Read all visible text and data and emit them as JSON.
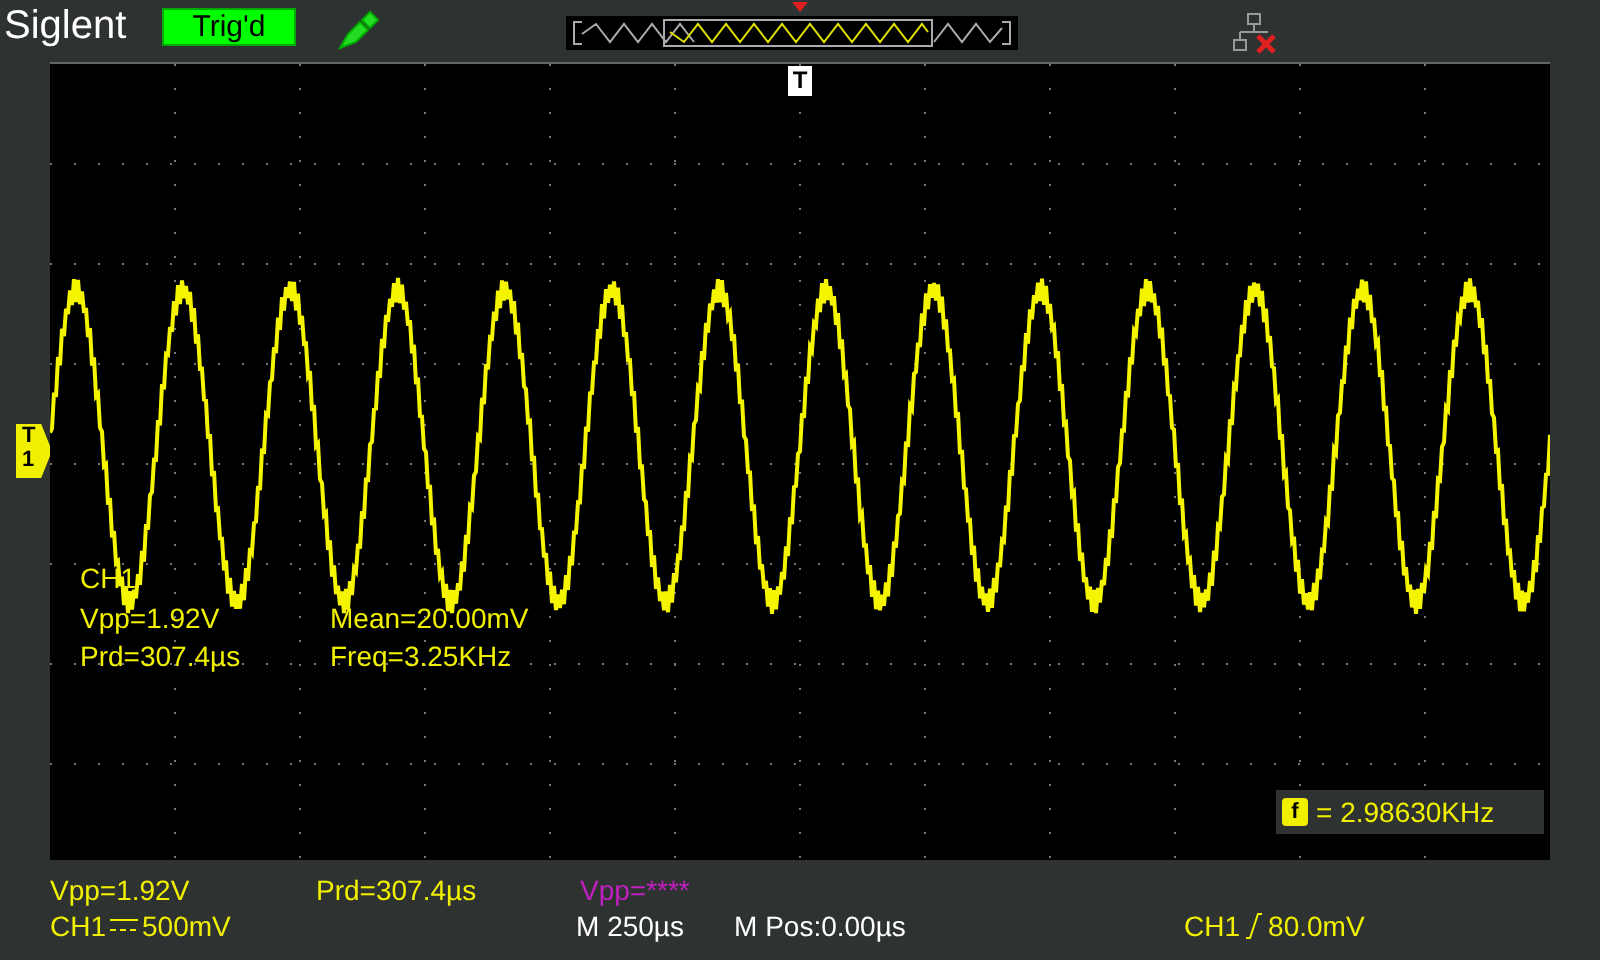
{
  "header": {
    "brand": "Siglent",
    "trigger_status": "Trig'd"
  },
  "markers": {
    "trigger_position": "T",
    "channel_marker": [
      "T",
      "1"
    ]
  },
  "measurements": [
    {
      "label": "CH1"
    },
    {
      "label": "Vpp=1.92V"
    },
    {
      "label": "Mean=20.00mV"
    },
    {
      "label": "Prd=307.4µs"
    },
    {
      "label": "Freq=3.25KHz"
    }
  ],
  "frequency_counter": {
    "icon": "f",
    "value": "= 2.98630KHz"
  },
  "status_bar": {
    "readouts": [
      {
        "text": "Vpp=1.92V",
        "color": "#f0f000"
      },
      {
        "text": "Prd=307.4µs",
        "color": "#f0f000"
      },
      {
        "text": "Vpp=****",
        "color": "#c020c0"
      }
    ],
    "channel": {
      "name": "CH1",
      "scale": "500mV"
    },
    "timebase": "M 250µs",
    "position": "M Pos:0.00µs",
    "trigger": {
      "source": "CH1",
      "level": "80.0mV"
    }
  }
}
